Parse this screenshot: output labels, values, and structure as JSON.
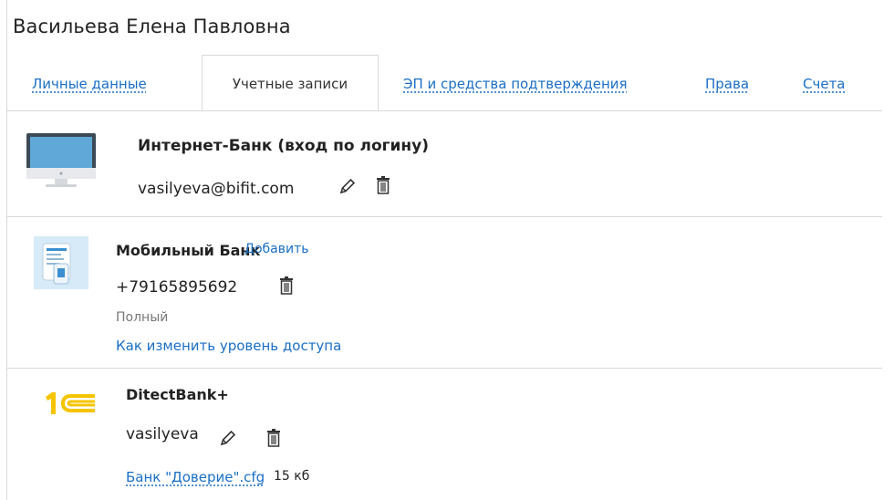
{
  "user_name": "Васильева Елена Павловна",
  "tabs": [
    {
      "label": "Личные данные",
      "active": false
    },
    {
      "label": "Учетные записи",
      "active": true
    },
    {
      "label": "ЭП и средства подтверждения",
      "active": false
    },
    {
      "label": "Права",
      "active": false
    },
    {
      "label": "Счета",
      "active": false
    }
  ],
  "accounts": {
    "internet_bank": {
      "title": "Интернет-Банк (вход по логину)",
      "login": "vasilyeva@bifit.com",
      "icons": [
        "monitor-icon",
        "pencil-icon",
        "trash-icon"
      ]
    },
    "mobile_bank": {
      "title": "Мобильный Банк",
      "add_label": "Добавить",
      "phone": "+79165895692",
      "access_level": "Полный",
      "access_help_link": "Как изменить уровень доступа",
      "icons": [
        "mobile-app-icon",
        "trash-icon"
      ]
    },
    "onec": {
      "title": "DitectBank+",
      "login": "vasilyeva",
      "file_name": "Банк \"Доверие\".cfg",
      "file_size": "15 кб",
      "icons": [
        "1c-logo-icon",
        "pencil-icon",
        "trash-icon"
      ]
    }
  },
  "colors": {
    "link": "#1a6fc4",
    "border": "#d9d9d9",
    "logo_1c": "#f5c400"
  }
}
